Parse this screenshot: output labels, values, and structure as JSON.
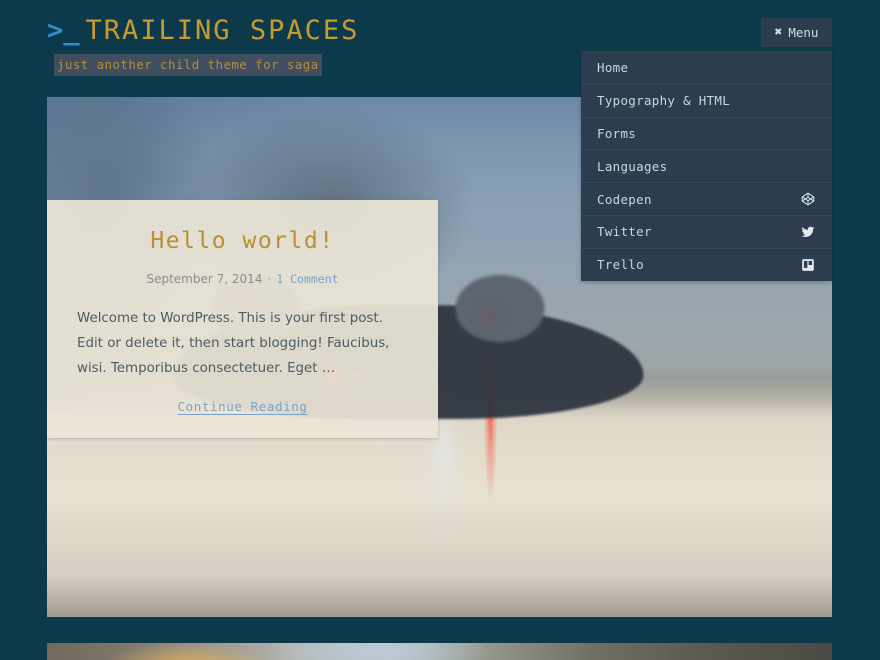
{
  "site": {
    "prompt": ">_",
    "title": "TRAILING SPACES",
    "tagline": "just another child theme for saga"
  },
  "menu_toggle": {
    "label": "Menu",
    "icon": "close-x-icon",
    "state": "open"
  },
  "nav": {
    "items": [
      {
        "label": "Home",
        "icon": null
      },
      {
        "label": "Typography & HTML",
        "icon": null
      },
      {
        "label": "Forms",
        "icon": null
      },
      {
        "label": "Languages",
        "icon": null
      },
      {
        "label": "Codepen",
        "icon": "codepen-icon"
      },
      {
        "label": "Twitter",
        "icon": "twitter-icon"
      },
      {
        "label": "Trello",
        "icon": "trello-icon"
      }
    ]
  },
  "post": {
    "title": "Hello world!",
    "date": "September 7, 2014",
    "separator": "·",
    "comments": "1 Comment",
    "excerpt": "Welcome to WordPress. This is your first post. Edit or delete it, then start blogging! Faucibus, wisi. Temporibus consectetuer. Eget …",
    "continue_label": "Continue Reading"
  },
  "colors": {
    "page_background": "#0d3a4b",
    "title_gold": "#c99a2e",
    "prompt_blue": "#2e8fd4",
    "menu_background": "#2b3d4f",
    "menu_text": "#ccd5dd",
    "card_background": "#ebe5d6",
    "link_blue": "#7ba3c9",
    "tagline_highlight": "#3f4f5f"
  }
}
